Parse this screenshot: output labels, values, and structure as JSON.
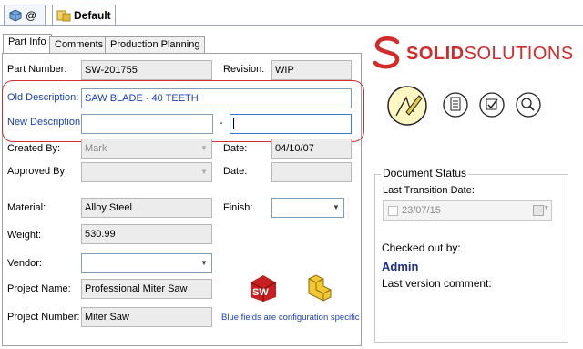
{
  "config_tabs": [
    {
      "label": "@",
      "icon": "part-icon"
    },
    {
      "label": "Default",
      "icon": "config-icon"
    }
  ],
  "form_tabs": [
    "Part Info",
    "Comments",
    "Production Planning"
  ],
  "fields": {
    "part_number_label": "Part Number:",
    "part_number_value": "SW-201755",
    "revision_label": "Revision:",
    "revision_value": "WIP",
    "old_description_label": "Old Description:",
    "old_description_value": "SAW BLADE - 40 TEETH",
    "new_description_label": "New Description",
    "new_description_value": "",
    "new_description_separator": "-",
    "new_description_suffix": "",
    "created_by_label": "Created By:",
    "created_by_value": "Mark",
    "created_date_label": "Date:",
    "created_date_value": "04/10/07",
    "approved_by_label": "Approved By:",
    "approved_by_value": "",
    "approved_date_label": "Date:",
    "approved_date_value": "",
    "material_label": "Material:",
    "material_value": "Alloy Steel",
    "finish_label": "Finish:",
    "finish_value": "",
    "weight_label": "Weight:",
    "weight_value": "530.99",
    "vendor_label": "Vendor:",
    "vendor_value": "",
    "project_name_label": "Project Name:",
    "project_name_value": "Professional Miter Saw",
    "project_number_label": "Project Number:",
    "project_number_value": "Miter Saw"
  },
  "config_note": "Blue fields are configuration specific",
  "logo": {
    "text_bold": "SOLID",
    "text_rest": "SOLUTIONS",
    "color": "#d32a2a"
  },
  "document_status": {
    "title": "Document Status",
    "last_transition_label": "Last Transition Date:",
    "last_transition_value": "23/07/15",
    "checked_out_label": "Checked out by:",
    "checked_out_value": "Admin",
    "last_comment_label": "Last version comment:"
  },
  "colors": {
    "accent_blue": "#1a3fb8",
    "highlight_red": "#d23030",
    "admin_blue": "#1f2f8a"
  }
}
